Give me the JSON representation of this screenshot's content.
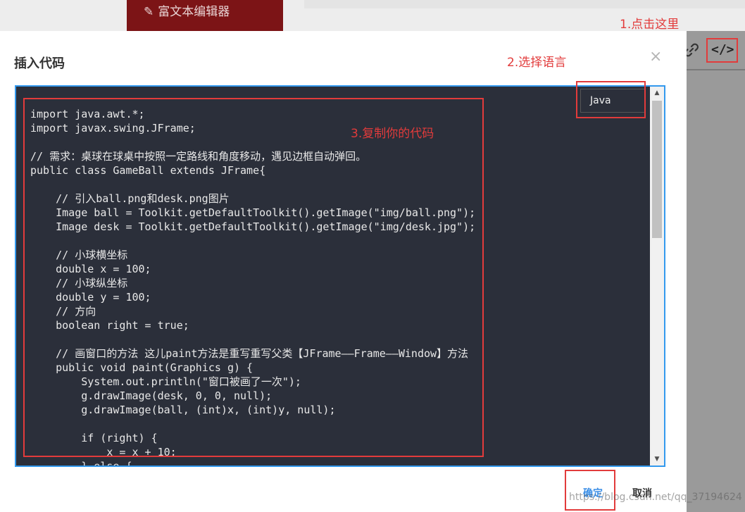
{
  "background": {
    "editor_tab_label": "富文本编辑器",
    "toolbar_icons": [
      "link-icon",
      "code-icon"
    ]
  },
  "annotations": {
    "step1": "1.点击这里",
    "step2": "2.选择语言",
    "step3": "3.复制你的代码",
    "color": "#e23b3b"
  },
  "dialog": {
    "title": "插入代码",
    "close_symbol": "×",
    "language_selected": "Java",
    "code_lines": [
      "import java.awt.*;",
      "import javax.swing.JFrame;",
      "",
      "// 需求：桌球在球桌中按照一定路线和角度移动，遇见边框自动弹回。",
      "public class GameBall extends JFrame{",
      "",
      "    // 引入ball.png和desk.png图片",
      "    Image ball = Toolkit.getDefaultToolkit().getImage(\"img/ball.png\");",
      "    Image desk = Toolkit.getDefaultToolkit().getImage(\"img/desk.jpg\");",
      "",
      "    // 小球横坐标",
      "    double x = 100;",
      "    // 小球纵坐标",
      "    double y = 100;",
      "    // 方向",
      "    boolean right = true;",
      "",
      "    // 画窗口的方法 这儿paint方法是重写重写父类【JFrame——Frame——Window】方法",
      "    public void paint(Graphics g) {",
      "        System.out.println(\"窗口被画了一次\");",
      "        g.drawImage(desk, 0, 0, null);",
      "        g.drawImage(ball, (int)x, (int)y, null);",
      "",
      "        if (right) {",
      "            x = x + 10;",
      "        } else {"
    ],
    "ok_label": "确定",
    "cancel_label": "取消",
    "accent_color": "#3399ee"
  },
  "watermark": "https://blog.csdn.net/qq_37194624"
}
